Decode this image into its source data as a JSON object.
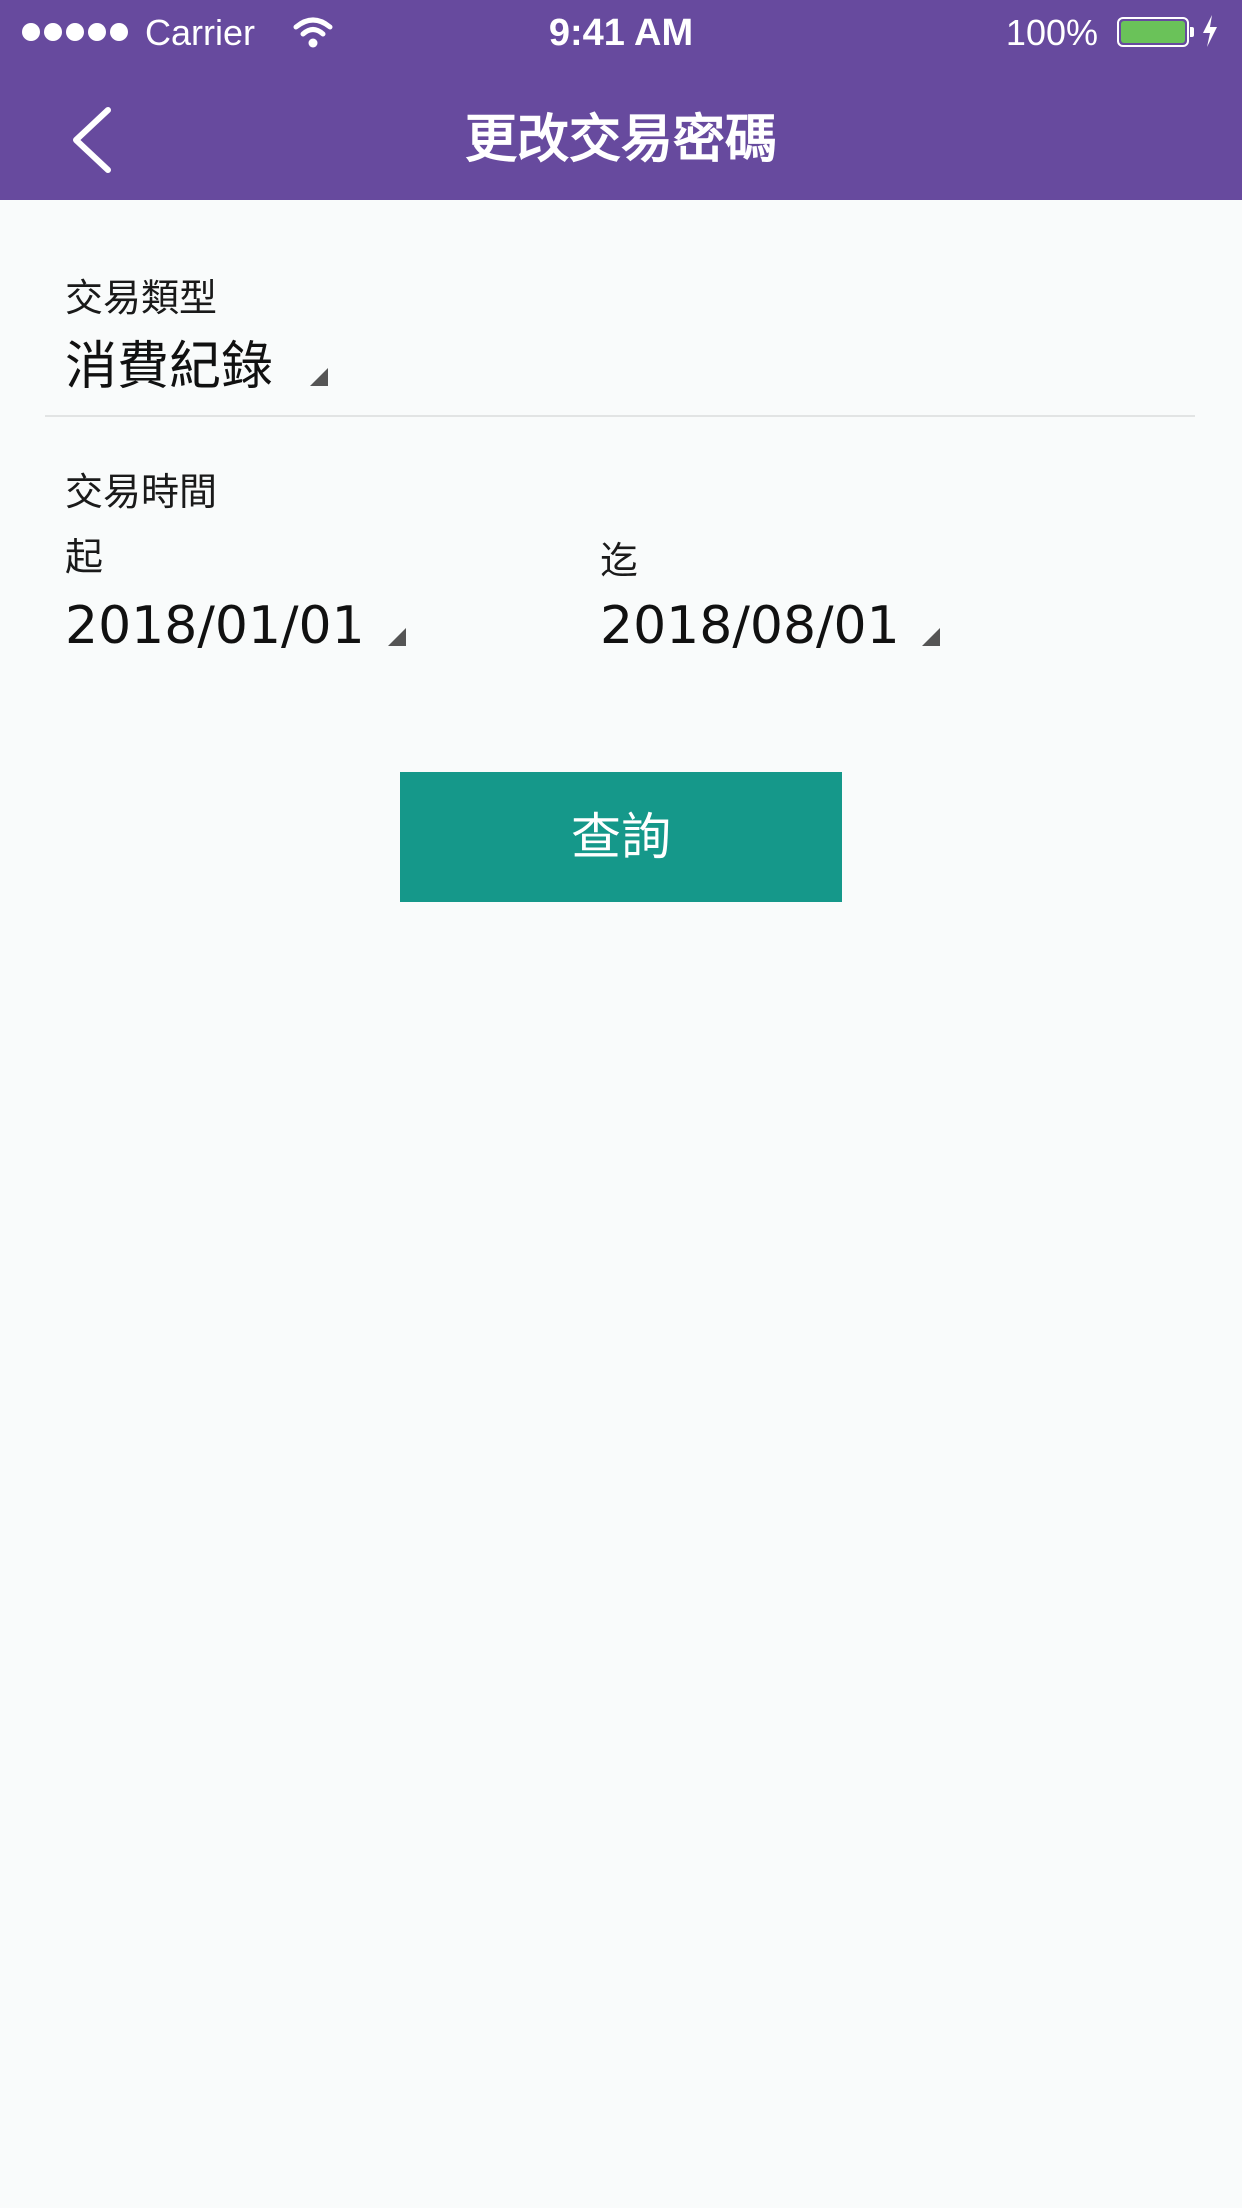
{
  "status_bar": {
    "carrier": "Carrier",
    "time": "9:41 AM",
    "battery": "100%"
  },
  "header": {
    "title": "更改交易密碼",
    "back_icon": "chevron-left-icon",
    "background_color": "#674a9e"
  },
  "form": {
    "transaction_type": {
      "label": "交易類型",
      "value": "消費紀錄"
    },
    "transaction_time": {
      "label": "交易時間",
      "from_label": "起",
      "from_value": "2018/01/01",
      "to_label": "迄",
      "to_value": "2018/08/01"
    },
    "query_button": {
      "label": "查詢",
      "color": "#15988a"
    }
  }
}
